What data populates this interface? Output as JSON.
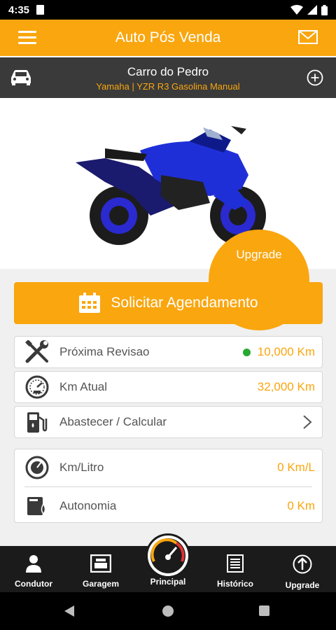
{
  "status_bar": {
    "time": "4:35"
  },
  "app_bar": {
    "title": "Auto Pós Venda",
    "menu_icon": "hamburger-menu-icon",
    "mail_icon": "mail-icon"
  },
  "vehicle": {
    "name": "Carro do Pedro",
    "model": "Yamaha | YZR R3 Gasolina Manual",
    "car_icon": "car-icon",
    "add_icon": "plus-circle-icon"
  },
  "photo": {
    "upgrade_label": "Upgrade"
  },
  "schedule_button": {
    "label": "Solicitar Agendamento",
    "icon": "calendar-icon"
  },
  "cards": {
    "revisao": {
      "label": "Próxima Revisao",
      "value": "10,000 Km",
      "icon": "wrench-screwdriver-icon",
      "status_color": "#27a830"
    },
    "km_atual": {
      "label": "Km Atual",
      "value": "32,000 Km",
      "icon": "speedometer-icon"
    },
    "abastecer": {
      "label": "Abastecer / Calcular",
      "icon": "fuel-pump-icon"
    }
  },
  "consumption": {
    "km_litro": {
      "label": "Km/Litro",
      "value": "0 Km/L",
      "icon": "gauge-icon"
    },
    "autonomia": {
      "label": "Autonomia",
      "value": "0 Km",
      "icon": "fuel-drop-icon"
    }
  },
  "bottom_nav": {
    "condutor": "Condutor",
    "garagem": "Garagem",
    "principal": "Principal",
    "historico": "Histórico",
    "upgrade": "Upgrade"
  },
  "colors": {
    "accent": "#f9a60f",
    "dark_bar": "#3a3a3a",
    "nav_bg": "#1b1b1b"
  }
}
